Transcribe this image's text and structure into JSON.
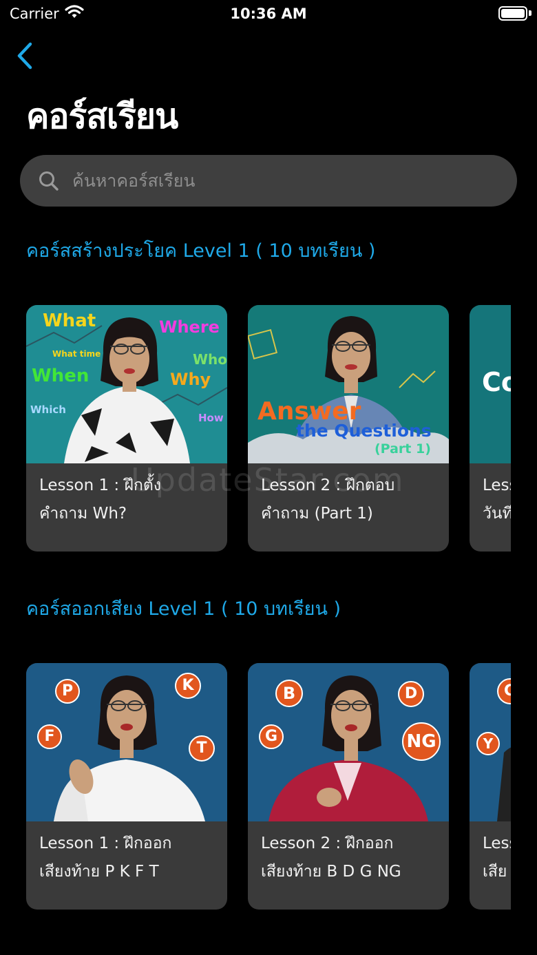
{
  "status_bar": {
    "carrier": "Carrier",
    "time": "10:36 AM"
  },
  "header": {
    "title": "คอร์สเรียน"
  },
  "search": {
    "placeholder": "ค้นหาคอร์สเรียน",
    "value": ""
  },
  "sections": [
    {
      "title": "คอร์สสร้างประโยค Level 1 ( 10 บทเรียน )",
      "lessons": [
        {
          "label": "Lesson 1 : ฝึกตั้ง\nคำถาม Wh?",
          "thumb_text": [
            "What",
            "Where",
            "What time",
            "Who",
            "When",
            "Why",
            "Which",
            "How"
          ]
        },
        {
          "label": "Lesson 2 : ฝึกตอบ\nคำถาม (Part 1)",
          "thumb_text": [
            "Answer",
            "the Questions",
            "(Part 1)"
          ]
        },
        {
          "label": "Less\nวันที",
          "thumb_text": [
            "Co"
          ]
        }
      ]
    },
    {
      "title": "คอร์สออกเสียง Level 1 ( 10 บทเรียน )",
      "lessons": [
        {
          "label": "Lesson 1 : ฝึกออก\nเสียงท้าย P K F T",
          "thumb_text": [
            "P",
            "K",
            "F",
            "T"
          ]
        },
        {
          "label": "Lesson 2 : ฝึกออก\nเสียงท้าย B D G NG",
          "thumb_text": [
            "B",
            "D",
            "G",
            "NG"
          ]
        },
        {
          "label": "Less\nเสีย",
          "thumb_text": [
            "Y",
            "G"
          ]
        }
      ]
    }
  ],
  "watermark": "UpdateStar.com",
  "colors": {
    "accent": "#1fa9e8",
    "card_bg": "#3a3a3a",
    "search_bg": "#3f3f3f",
    "badge_orange": "#e1561e"
  },
  "icons": {
    "back": "chevron-left-icon",
    "search": "search-icon",
    "wifi": "wifi-icon",
    "battery": "battery-icon"
  }
}
